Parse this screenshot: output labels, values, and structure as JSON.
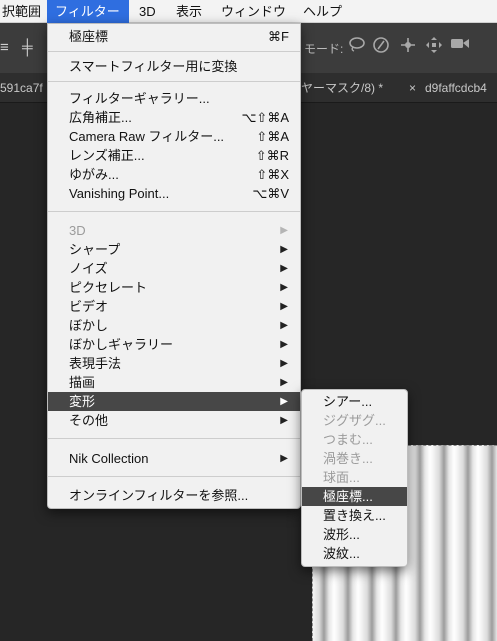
{
  "menubar": {
    "items": [
      "択範囲",
      "フィルター",
      "3D",
      "表示",
      "ウィンドウ",
      "ヘルプ"
    ],
    "active": "フィルター"
  },
  "toolbar": {
    "mode_label": "モード:",
    "icons": [
      "lasso-icon",
      "rotate-3d-icon",
      "pan-3d-icon",
      "move-3d-icon",
      "video-camera-icon"
    ]
  },
  "tabs": {
    "left_fragment": "591ca7f",
    "middle_fragment": "ヤーマスク/8) *",
    "close_glyph": "×",
    "right_tab": "d9faffcdcb4"
  },
  "filter_menu": {
    "top": [
      {
        "label": "極座標",
        "shortcut": "⌘F"
      }
    ],
    "smart": {
      "label": "スマートフィルター用に変換"
    },
    "special": [
      {
        "label": "フィルターギャラリー...",
        "shortcut": ""
      },
      {
        "label": "広角補正...",
        "shortcut": "⌥⇧⌘A"
      },
      {
        "label": "Camera Raw フィルター...",
        "shortcut": "⇧⌘A"
      },
      {
        "label": "レンズ補正...",
        "shortcut": "⇧⌘R"
      },
      {
        "label": "ゆがみ...",
        "shortcut": "⇧⌘X"
      },
      {
        "label": "Vanishing Point...",
        "shortcut": "⌥⌘V"
      }
    ],
    "categories": [
      {
        "label": "3D",
        "disabled": true
      },
      {
        "label": "シャープ",
        "disabled": false
      },
      {
        "label": "ノイズ",
        "disabled": false
      },
      {
        "label": "ピクセレート",
        "disabled": false
      },
      {
        "label": "ビデオ",
        "disabled": false
      },
      {
        "label": "ぼかし",
        "disabled": false
      },
      {
        "label": "ぼかしギャラリー",
        "disabled": false
      },
      {
        "label": "表現手法",
        "disabled": false
      },
      {
        "label": "描画",
        "disabled": false
      },
      {
        "label": "変形",
        "disabled": false,
        "highlight": true
      },
      {
        "label": "その他",
        "disabled": false
      }
    ],
    "nik": {
      "label": "Nik Collection"
    },
    "online": {
      "label": "オンラインフィルターを参照..."
    },
    "submenu_arrow": "▶"
  },
  "distort_submenu": [
    {
      "label": "シアー...",
      "disabled": false
    },
    {
      "label": "ジグザグ...",
      "disabled": true
    },
    {
      "label": "つまむ...",
      "disabled": true
    },
    {
      "label": "渦巻き...",
      "disabled": true
    },
    {
      "label": "球面...",
      "disabled": true
    },
    {
      "label": "極座標...",
      "disabled": false,
      "highlight": true
    },
    {
      "label": "置き換え...",
      "disabled": false
    },
    {
      "label": "波形...",
      "disabled": false
    },
    {
      "label": "波紋...",
      "disabled": false
    }
  ]
}
